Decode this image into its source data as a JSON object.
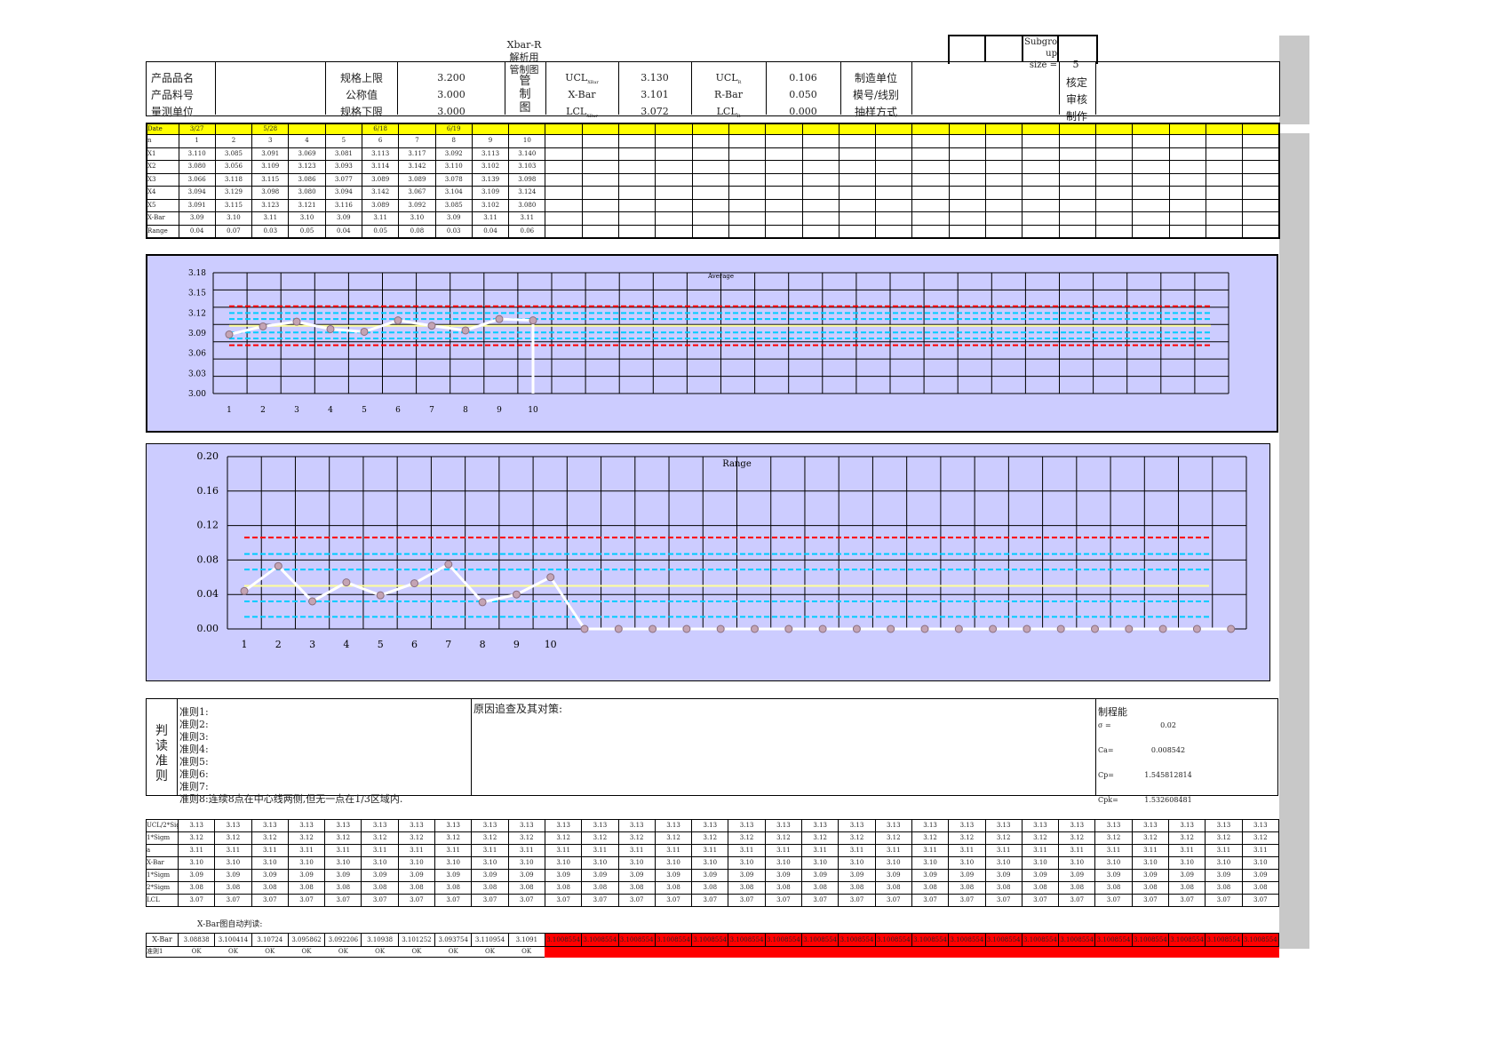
{
  "title": "Xbar-R\n解析用\n管制图",
  "subgroup": {
    "label": "Subgro\nup\nsize =",
    "value": "5"
  },
  "header": {
    "rows": [
      {
        "label": "产品品名",
        "spec_label": "规格上限",
        "spec_value": "3.200",
        "ctl_label": "UCL",
        "ctl_sub": "XBar",
        "ctl_value": "3.130",
        "r_label": "UCL",
        "r_sub": "R",
        "r_value": "0.106",
        "info_label": "制造单位",
        "approve": "核定"
      },
      {
        "label": "产品料号",
        "spec_label": "公称值",
        "spec_value": "3.000",
        "ctl_label": "X-Bar",
        "ctl_sub": "",
        "ctl_value": "3.101",
        "r_label": "R-Bar",
        "r_sub": "",
        "r_value": "0.050",
        "info_label": "模号/线别",
        "approve": "审核"
      },
      {
        "label": "量测单位",
        "spec_label": "规格下限",
        "spec_value": "3.000",
        "ctl_label": "LCL",
        "ctl_sub": "XBar",
        "ctl_value": "3.072",
        "r_label": "LCL",
        "r_sub": "R",
        "r_value": "0.000",
        "info_label": "抽样方式",
        "approve": "制作"
      }
    ],
    "chart_char": "管\n制\n图"
  },
  "data_table": {
    "row_labels": [
      "Date",
      "n",
      "X1",
      "X2",
      "X3",
      "X4",
      "X5",
      "X-Bar",
      "Range"
    ],
    "dates": [
      "3/27",
      "",
      "5/28",
      "",
      "",
      "6/18",
      "",
      "6/19",
      "",
      ""
    ],
    "n": [
      "1",
      "2",
      "3",
      "4",
      "5",
      "6",
      "7",
      "8",
      "9",
      "10"
    ],
    "x1": [
      "3.110",
      "3.085",
      "3.091",
      "3.069",
      "3.081",
      "3.113",
      "3.117",
      "3.092",
      "3.113",
      "3.140"
    ],
    "x2": [
      "3.080",
      "3.056",
      "3.109",
      "3.123",
      "3.093",
      "3.114",
      "3.142",
      "3.110",
      "3.102",
      "3.103"
    ],
    "x3": [
      "3.066",
      "3.118",
      "3.115",
      "3.086",
      "3.077",
      "3.089",
      "3.089",
      "3.078",
      "3.139",
      "3.098"
    ],
    "x4": [
      "3.094",
      "3.129",
      "3.098",
      "3.080",
      "3.094",
      "3.142",
      "3.067",
      "3.104",
      "3.109",
      "3.124"
    ],
    "x5": [
      "3.091",
      "3.115",
      "3.123",
      "3.121",
      "3.116",
      "3.089",
      "3.092",
      "3.085",
      "3.102",
      "3.080"
    ],
    "xbar": [
      "3.09",
      "3.10",
      "3.11",
      "3.10",
      "3.09",
      "3.11",
      "3.10",
      "3.09",
      "3.11",
      "3.11"
    ],
    "range": [
      "0.04",
      "0.07",
      "0.03",
      "0.05",
      "0.04",
      "0.05",
      "0.08",
      "0.03",
      "0.04",
      "0.06"
    ]
  },
  "chart_data": [
    {
      "type": "line",
      "title": "Average",
      "x": [
        1,
        2,
        3,
        4,
        5,
        6,
        7,
        8,
        9,
        10
      ],
      "ylim": [
        3.0,
        3.18
      ],
      "yticks": [
        "3.00",
        "3.03",
        "3.06",
        "3.09",
        "3.12",
        "3.15",
        "3.18"
      ],
      "series": [
        {
          "values": [
            3.088,
            3.1,
            3.107,
            3.096,
            3.092,
            3.109,
            3.101,
            3.094,
            3.111,
            3.109
          ]
        }
      ],
      "limits": {
        "ucl": 3.13,
        "center": 3.101,
        "lcl": 3.072,
        "sigma_lines": [
          3.091,
          3.111,
          3.12,
          3.082
        ]
      },
      "grid": true
    },
    {
      "type": "line",
      "title": "Range",
      "x": [
        1,
        2,
        3,
        4,
        5,
        6,
        7,
        8,
        9,
        10
      ],
      "ylim": [
        0.0,
        0.2
      ],
      "yticks": [
        "0.00",
        "0.04",
        "0.08",
        "0.12",
        "0.16",
        "0.20"
      ],
      "series": [
        {
          "values": [
            0.044,
            0.073,
            0.032,
            0.054,
            0.039,
            0.053,
            0.075,
            0.031,
            0.04,
            0.06
          ]
        }
      ],
      "limits": {
        "ucl": 0.106,
        "center": 0.05,
        "lcl": 0.0,
        "sigma_lines": [
          0.087,
          0.069,
          0.032,
          0.014
        ]
      },
      "grid": true
    }
  ],
  "rules": {
    "heading": "判\n读\n准\n则",
    "items": [
      "准则1:",
      "准则2:",
      "准则3:",
      "准则4:",
      "准则5:",
      "准则6:",
      "准则7:",
      "准则8:连续8点在中心线两侧,但无一点在1/3区域内."
    ],
    "cause_label": "原因追查及其对策:"
  },
  "capability": {
    "label": "制程能",
    "rows": [
      {
        "k": "σ =",
        "v": "0.02"
      },
      {
        "k": "Ca=",
        "v": "0.008542"
      },
      {
        "k": "Cp=",
        "v": "1.545812814"
      },
      {
        "k": "Cpk=",
        "v": "1.532608481"
      }
    ]
  },
  "sigma_table": {
    "row_labels": [
      "UCL/2*Sigm",
      "1*Sigm",
      "a",
      "X-Bar",
      "1*Sigm",
      "2*Sigm",
      "LCL"
    ],
    "row_values": [
      "3.13",
      "3.12",
      "3.11",
      "3.10",
      "3.09",
      "3.08",
      "3.07"
    ]
  },
  "judge": {
    "label": "X-Bar图自动判读:",
    "xbar_label": "X-Bar",
    "rule_label": "准则1",
    "xbar_values": [
      "3.08838",
      "3.100414",
      "3.10724",
      "3.095862",
      "3.092206",
      "3.10938",
      "3.101252",
      "3.093754",
      "3.110954",
      "3.1091"
    ],
    "filler": "3.1008554",
    "ok": "OK",
    "colors": {
      "alert": "#ff0000",
      "highlight": "#ffff00",
      "chart_bg": "#ccccff",
      "ucl": "#ff0000",
      "sigma": "#00ccff",
      "center": "#ffff99"
    }
  }
}
